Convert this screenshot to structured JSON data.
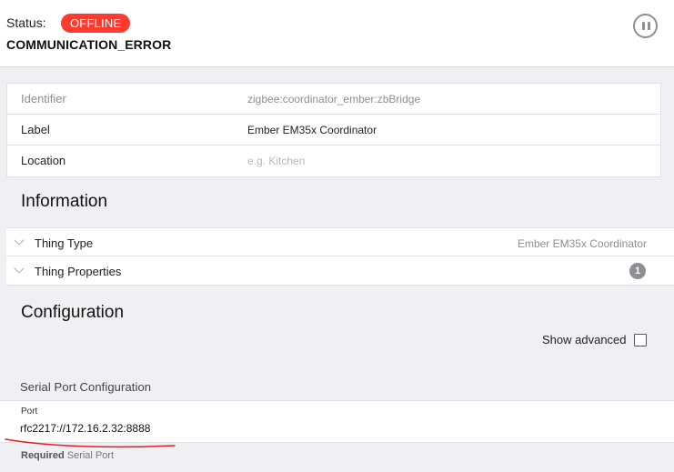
{
  "status": {
    "label": "Status:",
    "badge": "OFFLINE",
    "badge_color": "#ff3b30",
    "detail": "COMMUNICATION_ERROR",
    "pause_icon": "pause-circle-icon"
  },
  "properties": [
    {
      "name": "Identifier",
      "value": "zigbee:coordinator_ember:zbBridge"
    },
    {
      "name": "Label",
      "value": "Ember EM35x Coordinator"
    },
    {
      "name": "Location",
      "placeholder": "e.g. Kitchen"
    }
  ],
  "information": {
    "title": "Information",
    "rows": [
      {
        "name": "Thing Type",
        "value": "Ember EM35x Coordinator"
      },
      {
        "name": "Thing Properties",
        "count": "1"
      }
    ]
  },
  "configuration": {
    "title": "Configuration",
    "show_advanced": "Show advanced",
    "group": "Serial Port Configuration",
    "port": {
      "label": "Port",
      "value": "rfc2217://172.16.2.32:8888",
      "required": "Required",
      "hint": "Serial Port"
    }
  },
  "annotation_color": "#e0202a"
}
